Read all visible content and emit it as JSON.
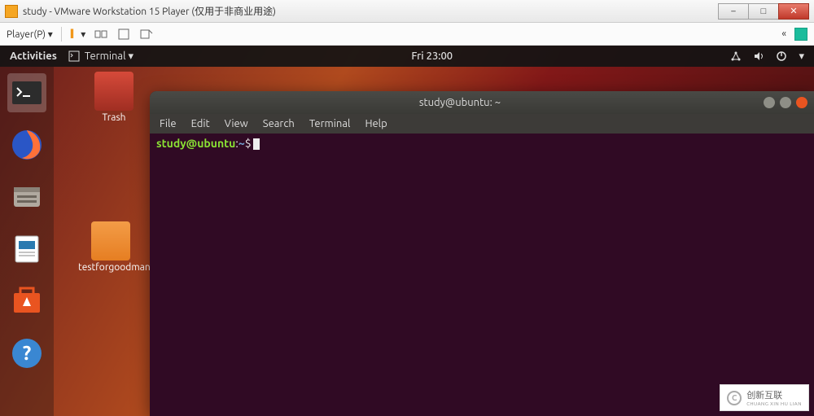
{
  "windows": {
    "title": "study - VMware Workstation 15 Player (仅用于非商业用途)",
    "controls": {
      "min": "–",
      "max": "□",
      "close": "✕"
    }
  },
  "vmware_toolbar": {
    "player_menu": "Player(P) ▾",
    "pause": "||",
    "collapse": "«"
  },
  "ubuntu_bar": {
    "activities": "Activities",
    "app_menu": "Terminal ▾",
    "clock": "Fri 23:00"
  },
  "desktop_icons": {
    "trash": "Trash",
    "folder": "testforgoodman"
  },
  "terminal": {
    "title": "study@ubuntu: ~",
    "menus": [
      "File",
      "Edit",
      "View",
      "Search",
      "Terminal",
      "Help"
    ],
    "prompt_user": "study@ubuntu",
    "prompt_sep": ":",
    "prompt_path": "~",
    "prompt_end": "$"
  },
  "watermark": {
    "brand": "创新互联",
    "sub": "CHUANG XIN HU LIAN"
  }
}
